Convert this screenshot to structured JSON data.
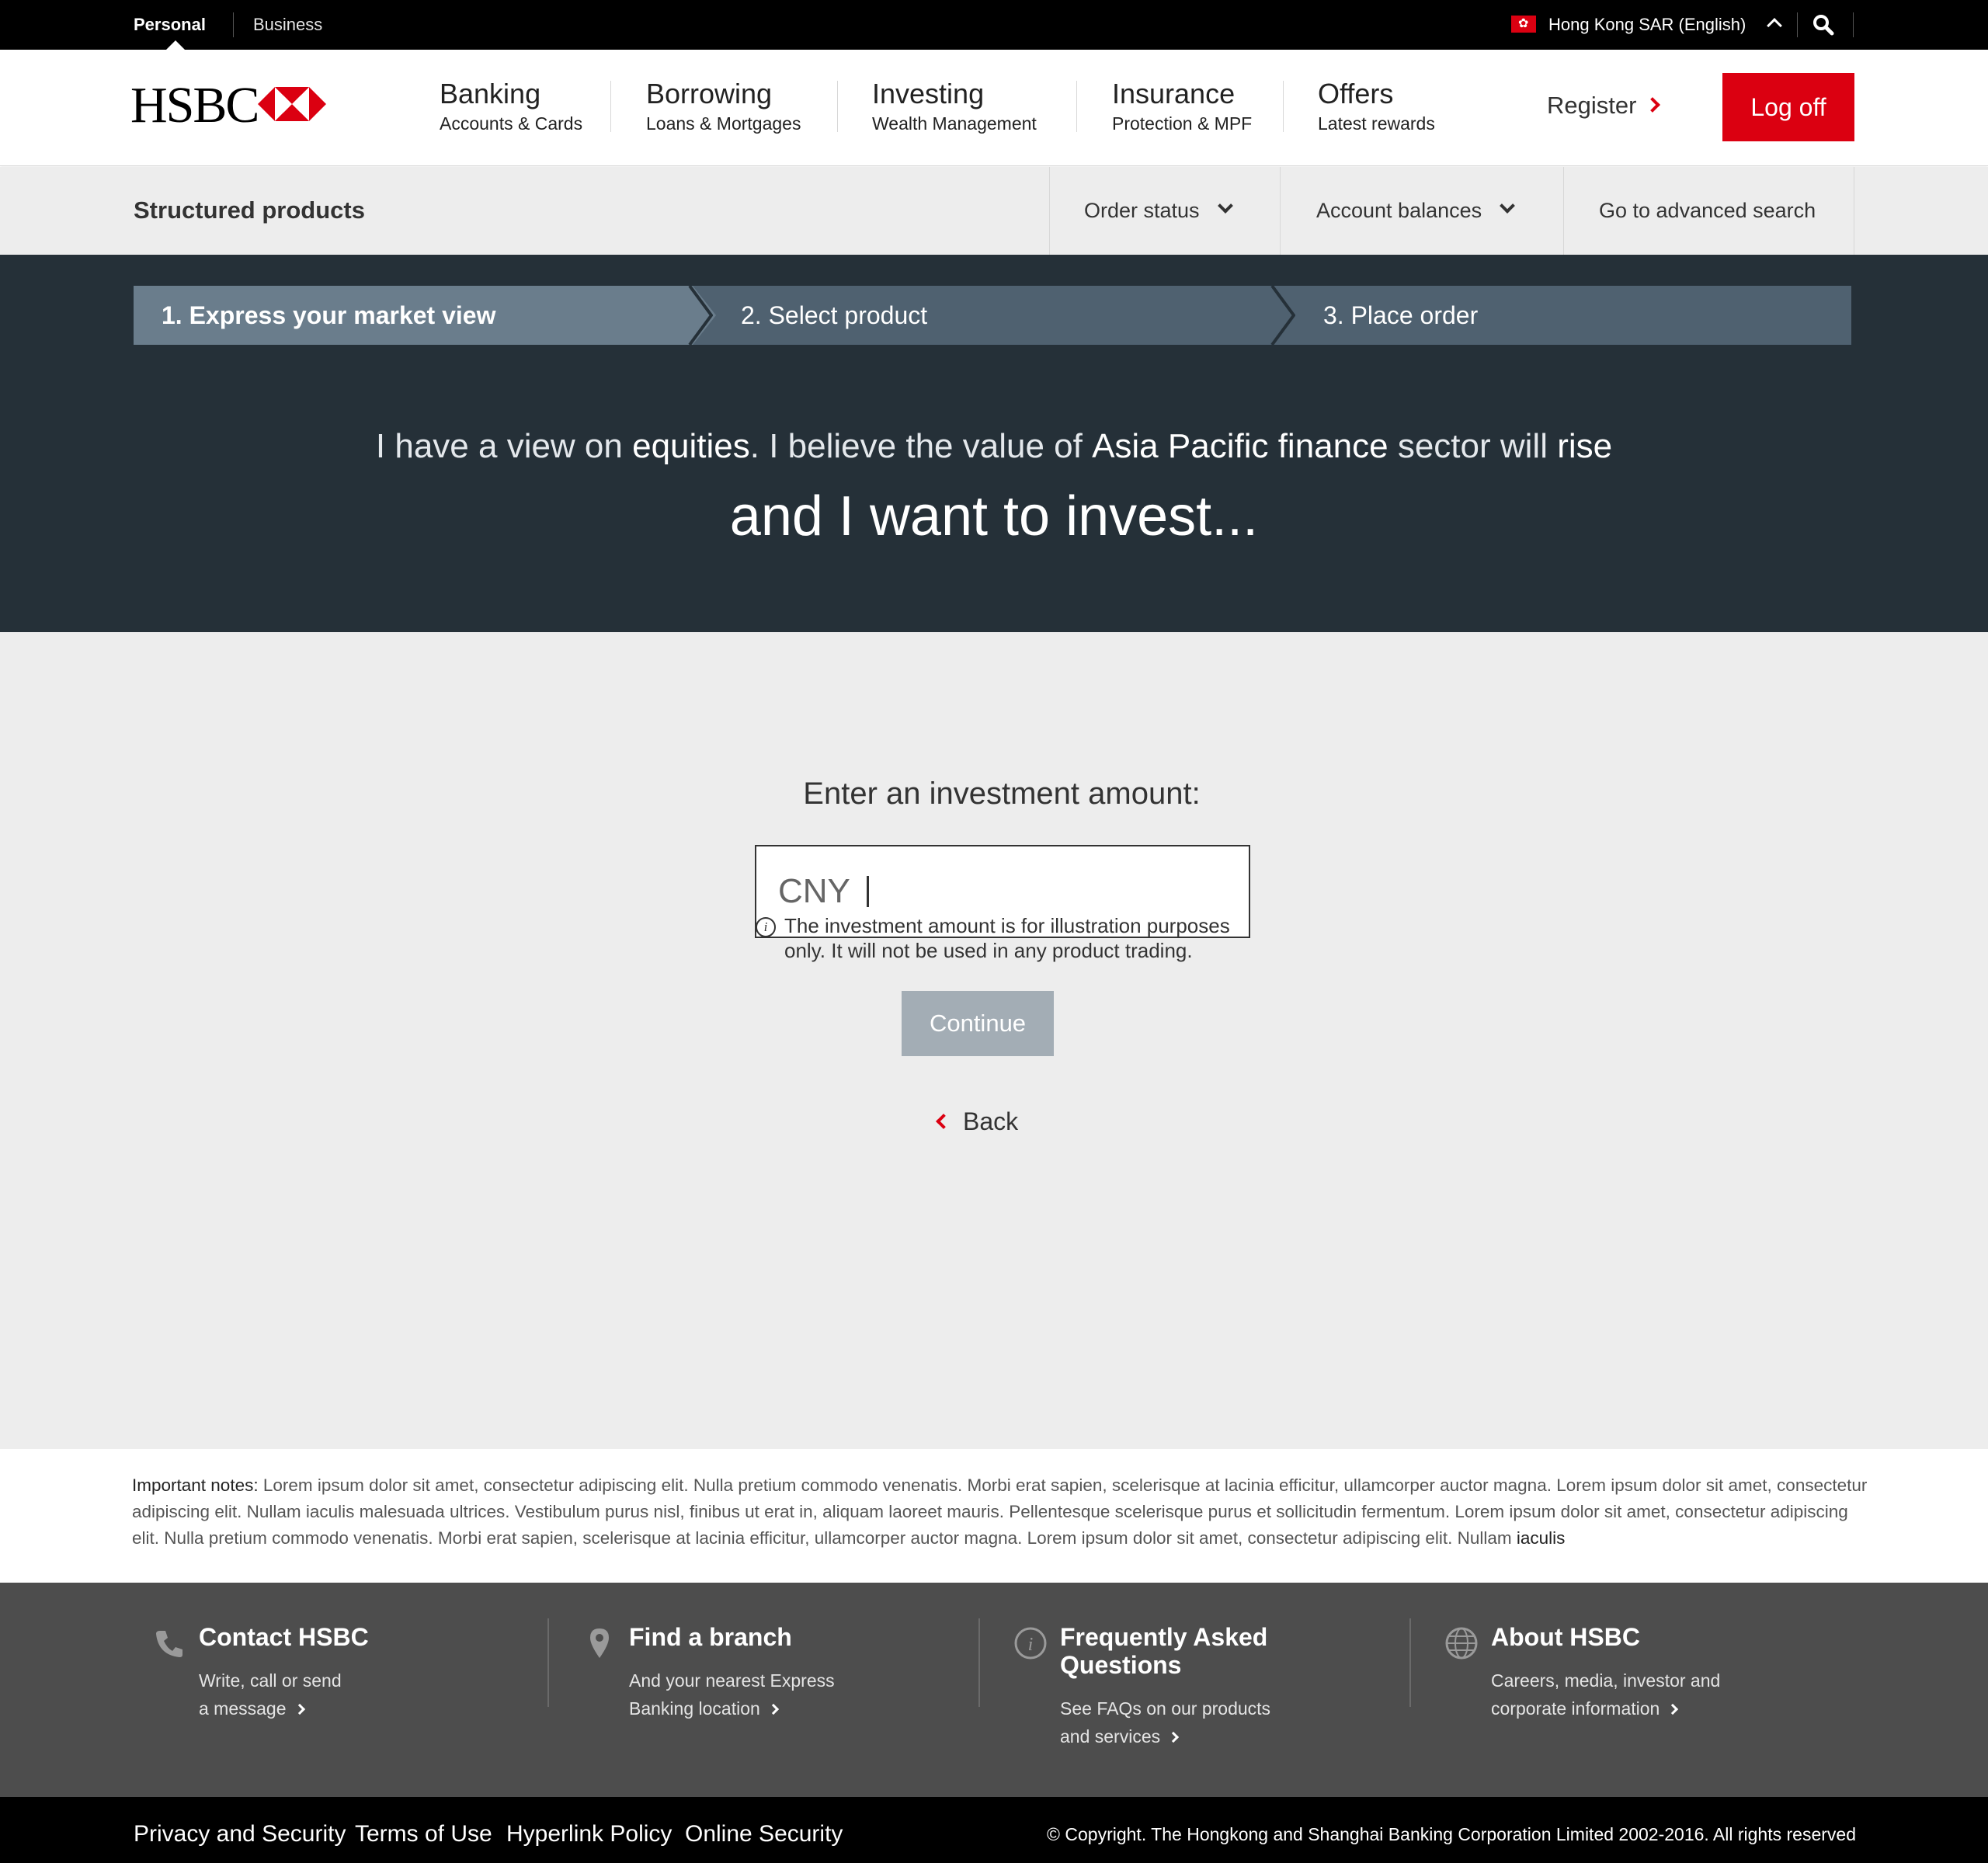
{
  "topbar": {
    "personal": "Personal",
    "business": "Business",
    "region": "Hong Kong SAR (English)",
    "flag_icon": "hong-kong-flag-icon",
    "search_icon": "search-icon"
  },
  "header": {
    "logo": "HSBC",
    "nav": [
      {
        "title": "Banking",
        "subtitle": "Accounts & Cards"
      },
      {
        "title": "Borrowing",
        "subtitle": "Loans & Mortgages"
      },
      {
        "title": "Investing",
        "subtitle": "Wealth Management"
      },
      {
        "title": "Insurance",
        "subtitle": "Protection & MPF"
      },
      {
        "title": "Offers",
        "subtitle": "Latest rewards"
      }
    ],
    "register": "Register",
    "logoff": "Log off"
  },
  "subnav": {
    "title": "Structured products",
    "order_status": "Order status",
    "account_balances": "Account balances",
    "advanced_search": "Go to advanced search"
  },
  "steps": [
    {
      "label": "1. Express your market view",
      "active": true
    },
    {
      "label": "2. Select product",
      "active": false
    },
    {
      "label": "3. Place order",
      "active": false
    }
  ],
  "hero": {
    "p1": "I have a view on ",
    "asset": "equities",
    "p2": ". I believe the value of ",
    "sector": "Asia Pacific finance",
    "p3": " sector will ",
    "direction": "rise",
    "line2": "and I want to invest..."
  },
  "form": {
    "label": "Enter an investment amount:",
    "currency": "CNY",
    "value": "",
    "info": "The investment amount is for illustration purposes only. It will not be used in any product trading.",
    "continue": "Continue",
    "back": "Back"
  },
  "notes": {
    "label": "Important notes:",
    "text": " Lorem ipsum dolor sit amet, consectetur adipiscing elit. Nulla pretium commodo venenatis. Morbi erat sapien, scelerisque at lacinia efficitur, ullamcorper auctor magna. Lorem ipsum dolor sit amet, consectetur adipiscing elit. Nullam iaculis malesuada ultrices. Vestibulum purus nisl, finibus ut erat in, aliquam laoreet mauris. Pellentesque scelerisque purus et sollicitudin fermentum. Lorem ipsum dolor sit amet, consectetur adipiscing elit. Nulla pretium commodo venenatis. Morbi erat sapien, scelerisque at lacinia efficitur, ullamcorper auctor magna. Lorem ipsum dolor sit amet, consectetur adipiscing elit. Nullam ",
    "tail": "iaculis"
  },
  "footer": {
    "cols": [
      {
        "title": "Contact HSBC",
        "desc_line1": "Write, call or send",
        "desc_line2": "a message",
        "icon": "phone-icon"
      },
      {
        "title": "Find a branch",
        "desc_line1": "And your nearest Express",
        "desc_line2": "Banking location",
        "icon": "location-pin-icon"
      },
      {
        "title_line1": "Frequently Asked",
        "title_line2": "Questions",
        "desc_line1": "See FAQs on our products",
        "desc_line2": "and services",
        "icon": "info-icon"
      },
      {
        "title": "About HSBC",
        "desc_line1": "Careers, media, investor and",
        "desc_line2": "corporate information",
        "icon": "globe-icon"
      }
    ]
  },
  "bottombar": {
    "links": [
      "Privacy and Security",
      "Terms of Use",
      "Hyperlink Policy",
      "Online Security"
    ],
    "copyright": "© Copyright. The Hongkong and Shanghai Banking Corporation Limited 2002-2016. All rights reserved"
  },
  "colors": {
    "brand_red": "#db0011",
    "hero_bg": "#253038",
    "step_active": "#6a7d8c",
    "step_inactive": "#4f6170",
    "page_bg": "#ededed",
    "footer_bg": "#4d4d4d"
  }
}
